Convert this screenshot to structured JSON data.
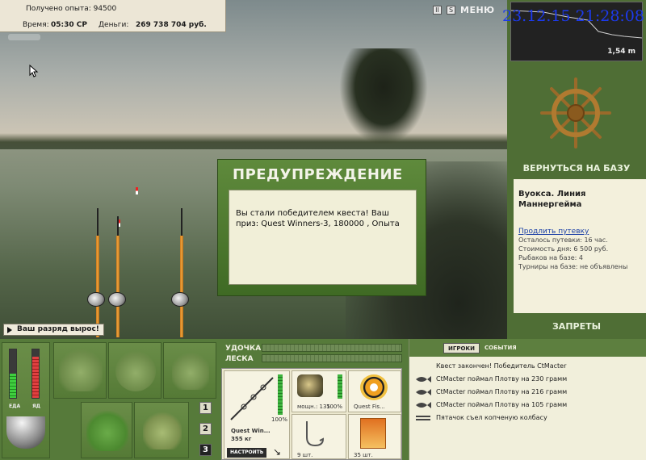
{
  "stats": {
    "experience": "Получено опыта: 94500",
    "time_label": "Время:",
    "time_value": "05:30 СР",
    "money_label": "Деньги:",
    "money_value": "269 738 704 руб."
  },
  "top_icons": {
    "pause": "II",
    "sound": "S",
    "menu_label": "МЕНЮ"
  },
  "timestamp": "23.12.15 21:28:08",
  "depth": {
    "value": "1,54 m"
  },
  "rank_badge": "Ваш разряд вырос!",
  "dialog": {
    "title": "ПРЕДУПРЕЖДЕНИЕ",
    "message": "Вы стали победителем квеста! Ваш приз: Quest Winners-3, 180000 , Опыта"
  },
  "base": {
    "back_label": "ВЕРНУТЬСЯ НА БАЗУ",
    "location": "Вуокса. Линия Маннергейма",
    "extend_link": "Продлить путевку",
    "rows": [
      "Осталось путевки: 16 час.",
      "Стоимость дня: 6 500 руб.",
      "Рыбаков на базе: 4",
      "Турниры на базе: не объявлены"
    ],
    "bans_label": "ЗАПРЕТЫ"
  },
  "meters": {
    "food_label": "ЕДА",
    "poison_label": "ЯД",
    "food_level": 0.5,
    "poison_level": 0.85
  },
  "inventory_pages": [
    "1",
    "2",
    "3"
  ],
  "tackle": {
    "rod_label": "УДОЧКА",
    "line_label": "ЛЕСКА",
    "rod_name": "Quest Win...",
    "rod_weight": "355 кг",
    "rod_percent": "100%",
    "setup_button": "НАСТРОИТЬ",
    "reel_label": "мощн.: 135",
    "reel_percent": "100%",
    "line_name": "Quest Fis...",
    "hook_count": "9 шт.",
    "bait_count": "35 шт."
  },
  "chat": {
    "tabs": [
      "ИГРОКИ",
      "СОБЫТИЯ"
    ],
    "rows": [
      "Квест закончен! Победитель CtMacter",
      "CtMacter поймал Плотву на 230 грамм",
      "CtMacter поймал Плотву на 216 грамм",
      "CtMacter поймал Плотву на 105 грамм",
      "Пятачок съел копченую колбасу"
    ]
  }
}
